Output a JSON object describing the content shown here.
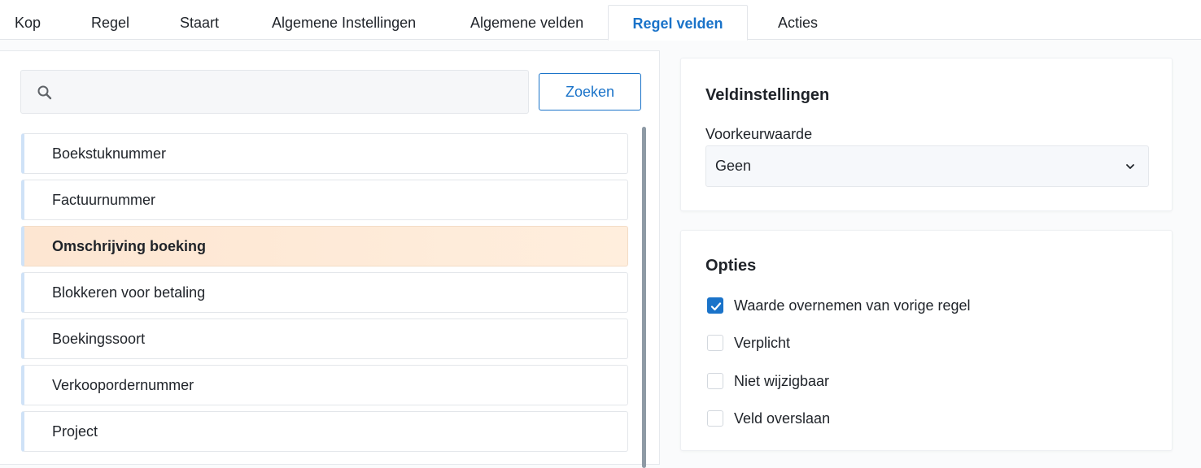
{
  "tabs": [
    {
      "label": "Kop",
      "active": false
    },
    {
      "label": "Regel",
      "active": false
    },
    {
      "label": "Staart",
      "active": false
    },
    {
      "label": "Algemene Instellingen",
      "active": false
    },
    {
      "label": "Algemene velden",
      "active": false
    },
    {
      "label": "Regel velden",
      "active": true
    },
    {
      "label": "Acties",
      "active": false
    }
  ],
  "search": {
    "value": "",
    "placeholder": "",
    "button_label": "Zoeken",
    "icon": "search-icon"
  },
  "fields": [
    {
      "label": "Boekstuknummer",
      "selected": false
    },
    {
      "label": "Factuurnummer",
      "selected": false
    },
    {
      "label": "Omschrijving boeking",
      "selected": true
    },
    {
      "label": "Blokkeren voor betaling",
      "selected": false
    },
    {
      "label": "Boekingssoort",
      "selected": false
    },
    {
      "label": "Verkoopordernummer",
      "selected": false
    },
    {
      "label": "Project",
      "selected": false
    }
  ],
  "field_settings": {
    "title": "Veldinstellingen",
    "preference_label": "Voorkeurwaarde",
    "preference_value": "Geen"
  },
  "options": {
    "title": "Opties",
    "items": [
      {
        "label": "Waarde overnemen van vorige regel",
        "checked": true
      },
      {
        "label": "Verplicht",
        "checked": false
      },
      {
        "label": "Niet wijzigbaar",
        "checked": false
      },
      {
        "label": "Veld overslaan",
        "checked": false
      }
    ]
  },
  "colors": {
    "accent": "#1a73c9",
    "selected_row": "#fde6d2",
    "row_marker": "#cfe2f7"
  }
}
